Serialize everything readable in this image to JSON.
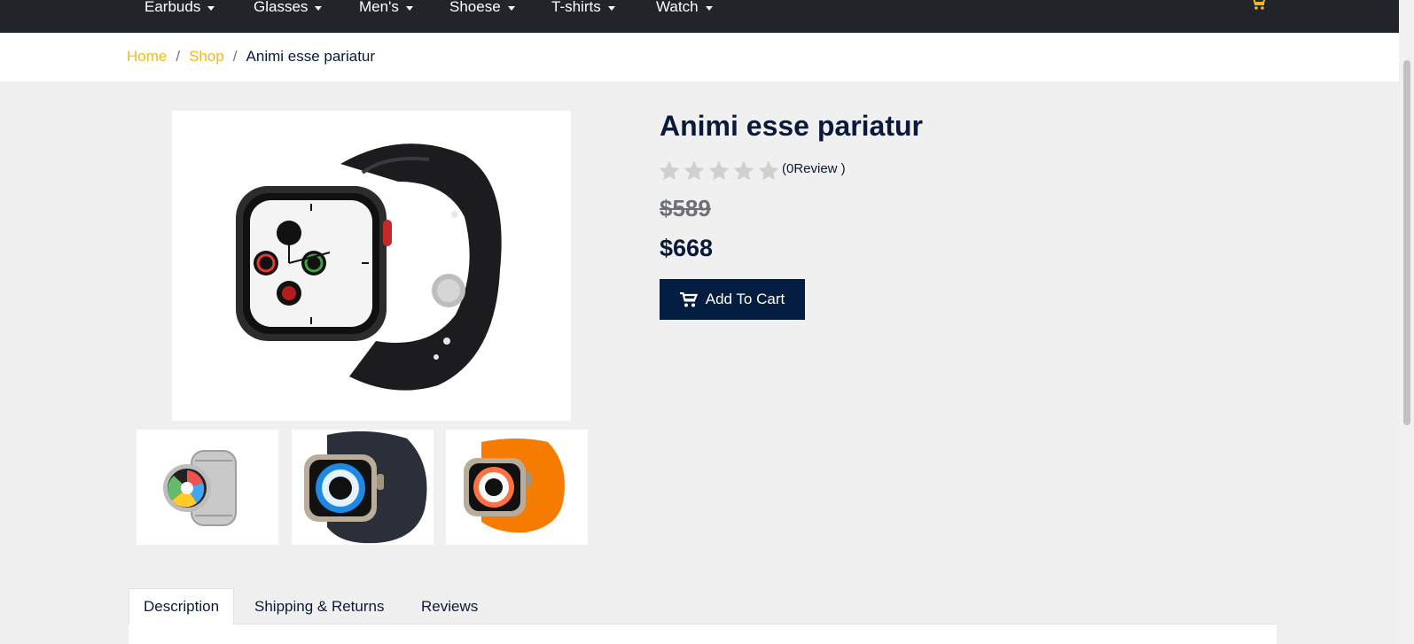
{
  "nav": {
    "items": [
      {
        "label": "Earbuds"
      },
      {
        "label": "Glasses"
      },
      {
        "label": "Men's"
      },
      {
        "label": "Shoese"
      },
      {
        "label": "T-shirts"
      },
      {
        "label": "Watch"
      }
    ],
    "cart_icon": "cart-icon"
  },
  "breadcrumb": {
    "home": "Home",
    "shop": "Shop",
    "separator": "/",
    "current": "Animi esse pariatur"
  },
  "product": {
    "title": "Animi esse pariatur",
    "rating": 0,
    "max_rating": 5,
    "review_text": "(0Review )",
    "old_price": "$589",
    "price": "$668",
    "add_to_cart_label": "Add To Cart",
    "images": {
      "main": "black smartwatch",
      "thumbs": [
        "silver round smartwatch",
        "titanium watch navy ocean band",
        "titanium watch orange ocean band"
      ]
    }
  },
  "tabs": [
    {
      "label": "Description",
      "active": true
    },
    {
      "label": "Shipping & Returns",
      "active": false
    },
    {
      "label": "Reviews",
      "active": false
    }
  ],
  "colors": {
    "nav_bg": "#212529",
    "accent": "#f5b914",
    "primary": "#041e42",
    "page_bg": "#f0f0f0"
  }
}
